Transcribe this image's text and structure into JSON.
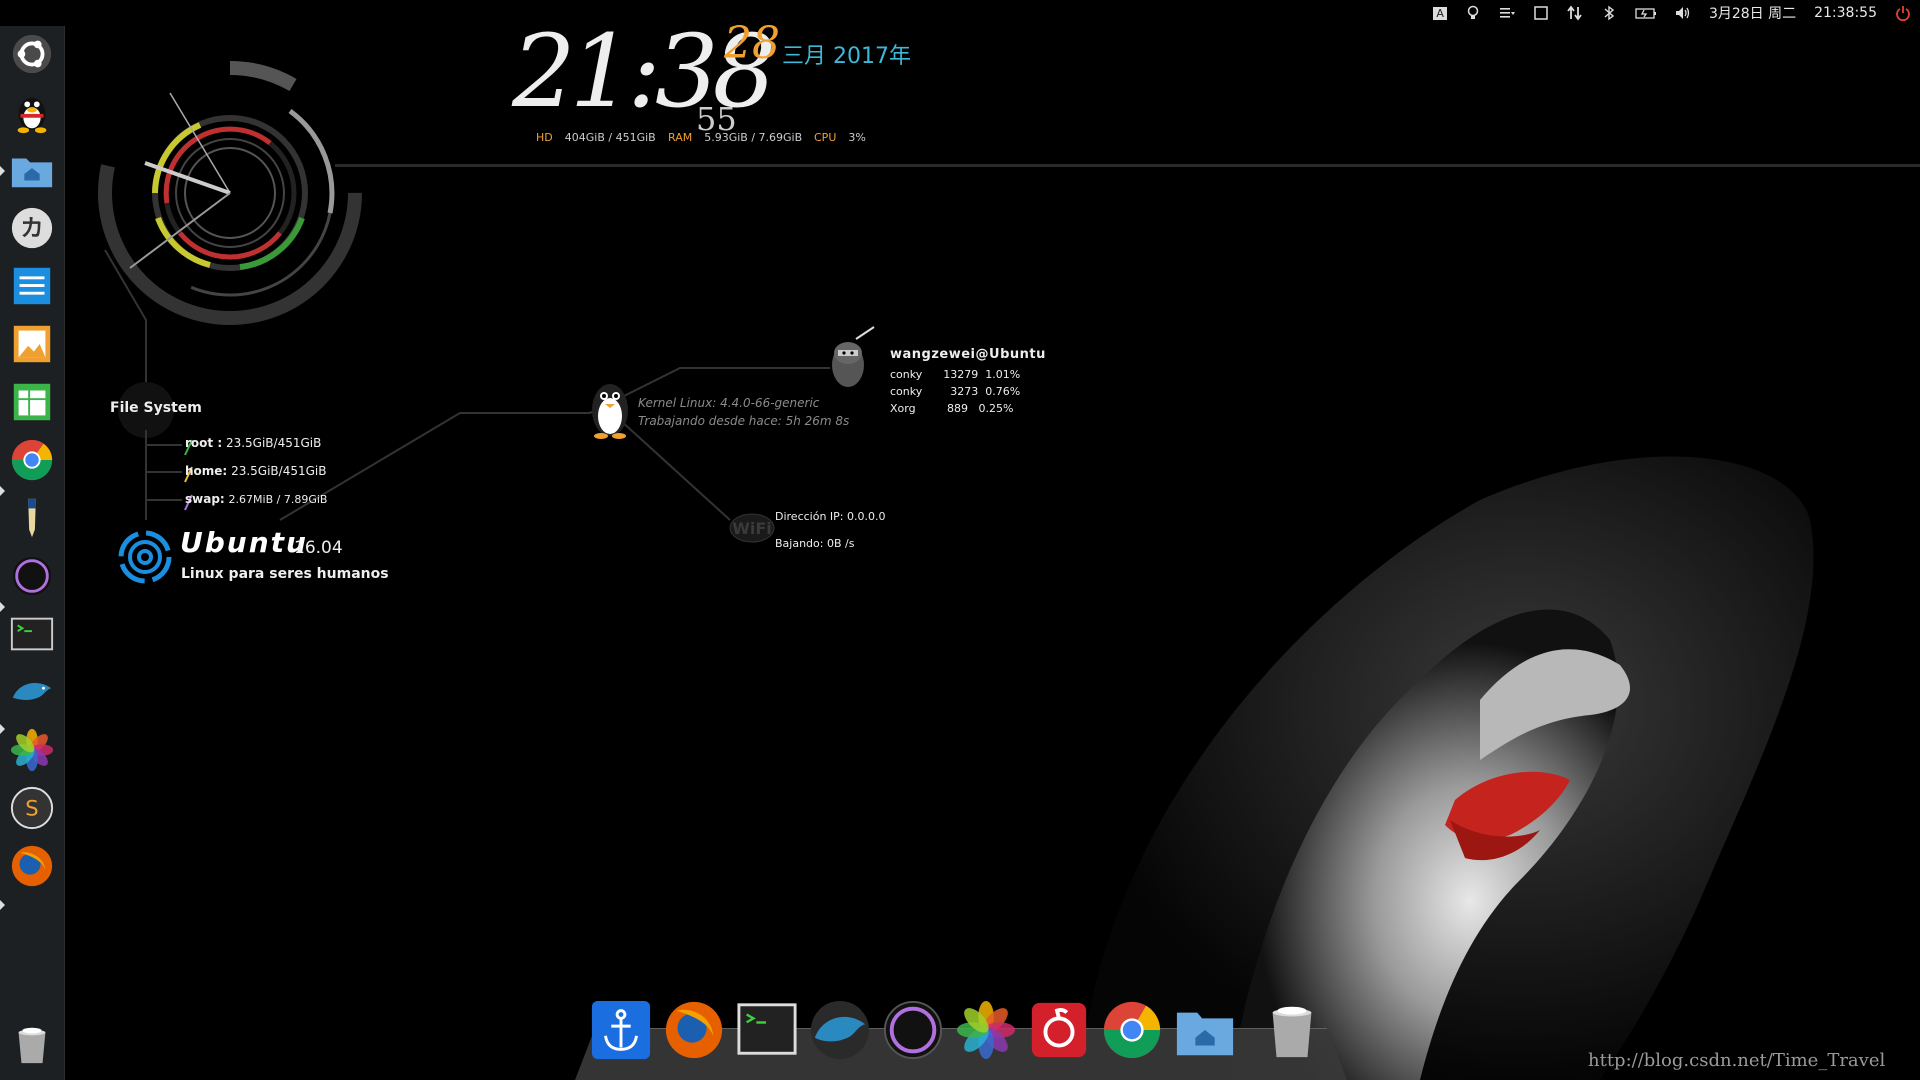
{
  "top_panel": {
    "keyboard": "A",
    "date": "3月28日 周二",
    "time": "21:38:55",
    "icons": [
      "keyboard-icon",
      "lightbulb-icon",
      "menu-icon",
      "window-icon",
      "network-icon",
      "bluetooth-icon",
      "battery-icon",
      "volume-icon",
      "power-icon"
    ]
  },
  "launcher": {
    "items": [
      "ubuntu-dash",
      "qq",
      "files",
      "katakana",
      "documents",
      "image-viewer",
      "spreadsheet",
      "chrome",
      "pen",
      "circle-app",
      "terminal",
      "mysql-workbench",
      "photos",
      "sublime-text",
      "firefox",
      "trash"
    ]
  },
  "conky": {
    "time": "21:38",
    "seconds": "55",
    "day": "28",
    "month_year": "三月  2017年",
    "hd_label": "HD",
    "hd_value": "404GiB / 451GiB",
    "ram_label": "RAM",
    "ram_value": "5.93GiB / 7.69GiB",
    "cpu_label": "CPU",
    "cpu_value": "3%",
    "fs_title": "File System",
    "fs": [
      {
        "name": "root :",
        "value": "23.5GiB/451GiB"
      },
      {
        "name": "home:",
        "value": "23.5GiB/451GiB"
      },
      {
        "name": "swap:",
        "value": "2.67MiB / 7.89GiB"
      }
    ],
    "distro": "Ubuntu",
    "distro_version": "16.04",
    "tagline": "Linux para seres humanos",
    "kernel": "Kernel Linux: 4.4.0-66-generic",
    "uptime": "Trabajando desde hace: 5h 26m 8s",
    "user": "wangzewei@Ubuntu",
    "processes": [
      "conky      13279  1.01%",
      "conky        3273  0.76%",
      "Xorg         889   0.25%"
    ],
    "ip": "Dirección IP: 0.0.0.0",
    "download": "Bajando: 0B  /s"
  },
  "dock": {
    "items": [
      "anchor",
      "firefox",
      "terminal",
      "mysql-workbench",
      "circle-app",
      "photos",
      "netease-music",
      "chrome",
      "home-folder",
      "trash"
    ]
  },
  "watermark": "http://blog.csdn.net/Time_Travel"
}
